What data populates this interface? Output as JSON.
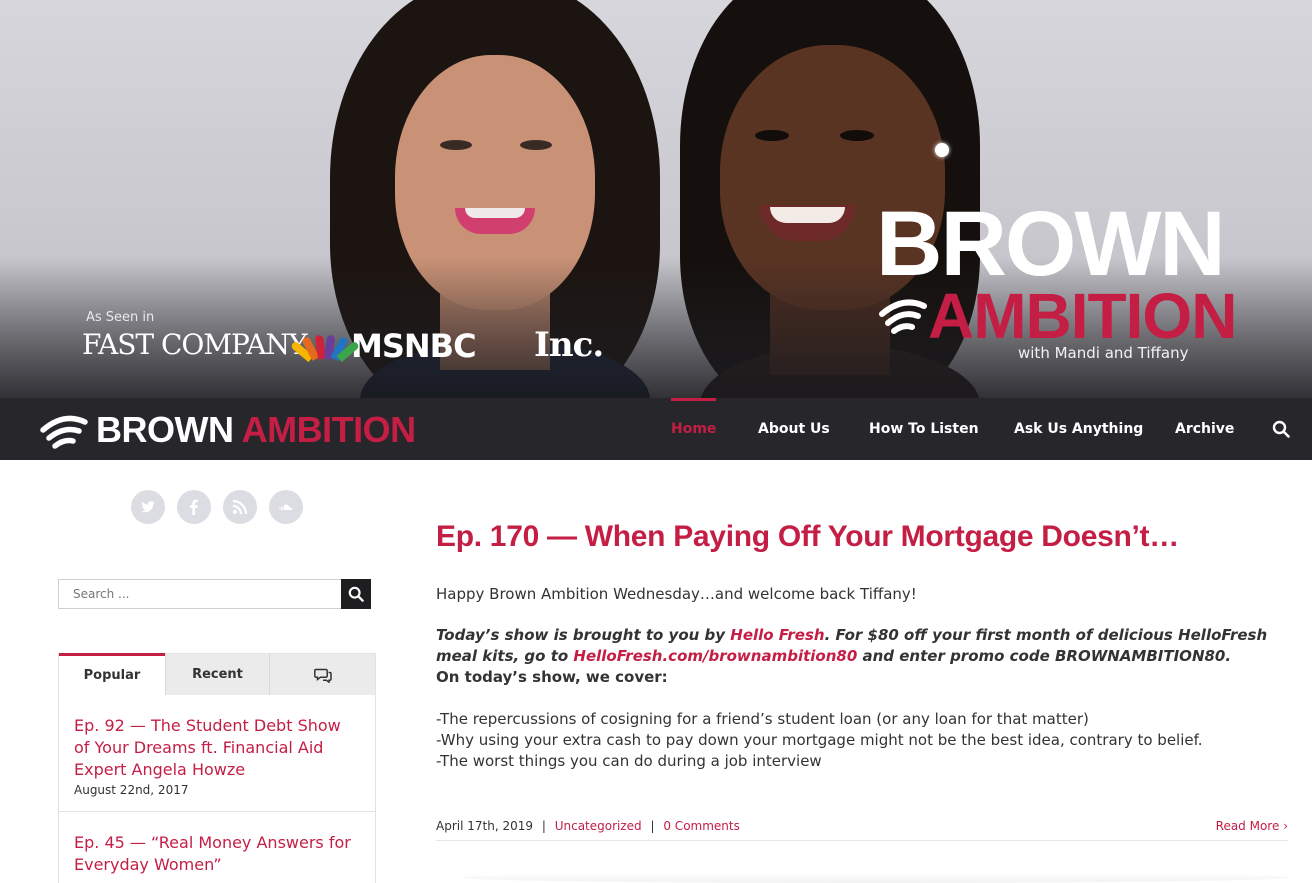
{
  "hero": {
    "seen_in": "As Seen in",
    "logos": [
      "FAST COMPANY",
      "MSNBC",
      "Inc."
    ],
    "show_title_line1": "BROWN",
    "show_title_line2": "AMBITION",
    "tagline": "with Mandi and Tiffany"
  },
  "brand": {
    "name_white": "BROWN",
    "name_red": "AMBITION"
  },
  "nav": {
    "items": [
      {
        "label": "Home",
        "active": true
      },
      {
        "label": "About Us",
        "active": false
      },
      {
        "label": "How To Listen",
        "active": false
      },
      {
        "label": "Ask Us Anything",
        "active": false
      },
      {
        "label": "Archive",
        "active": false
      }
    ],
    "search_icon": "search-icon"
  },
  "sidebar": {
    "social_icons": [
      "twitter-icon",
      "facebook-icon",
      "rss-icon",
      "soundcloud-icon"
    ],
    "search": {
      "placeholder": "Search ...",
      "value": ""
    },
    "tabs": [
      {
        "label": "Popular",
        "active": true
      },
      {
        "label": "Recent",
        "active": false
      },
      {
        "label": "",
        "icon": "comments-icon",
        "active": false
      }
    ],
    "posts": [
      {
        "title": "Ep. 92 — The Student Debt Show of Your Dreams ft. Financial Aid Expert Angela Howze",
        "date": "August 22nd, 2017"
      },
      {
        "title": "Ep. 45 — “Real Money Answers for Everyday Women”",
        "date": ""
      }
    ]
  },
  "article": {
    "title": "Ep. 170 — When Paying Off Your Mortgage Doesn’t…",
    "intro": "Happy Brown Ambition Wednesday…and welcome back Tiffany!",
    "sponsor": {
      "part1": "Today’s show is brought to you by ",
      "link1": "Hello Fresh",
      "part2": ". For $80 off your first month of delicious HelloFresh meal kits, go to ",
      "link2": "HelloFresh.com/brownambition80",
      "part3": " and enter promo code BROWNAMBITION80."
    },
    "cover_heading": "On today’s show, we cover:",
    "bullets": [
      "-The repercussions of cosigning for a friend’s student loan (or any loan for that matter)",
      "-Why using your extra cash to pay down your mortgage might not be the best idea, contrary to belief.",
      "-The worst things you can do during a job interview"
    ],
    "meta": {
      "date": "April 17th, 2019",
      "category": "Uncategorized",
      "comments": "0 Comments",
      "read_more": "Read More",
      "separator": "|"
    }
  },
  "colors": {
    "accent": "#c41e45",
    "navbar": "#27272b",
    "social_bg": "#dcdde3"
  }
}
